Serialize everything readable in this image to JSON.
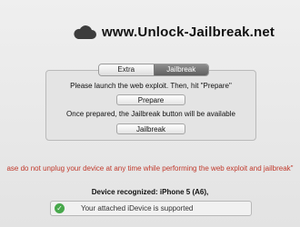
{
  "header": {
    "logo_icon": "cloud-icon",
    "site_title": "www.Unlock-Jailbreak.net"
  },
  "tabs": [
    {
      "label": "Extra",
      "active": false
    },
    {
      "label": "Jailbreak",
      "active": true
    }
  ],
  "panel": {
    "instruction_1": "Please launch the web exploit.  Then, hit \"Prepare\"",
    "prepare_label": "Prepare",
    "instruction_2": "Once prepared, the Jailbreak button will be available",
    "jailbreak_label": "Jailbreak"
  },
  "warning": "ase do not unplug your device at any time while performing the web exploit and jailbreak\"",
  "device": {
    "recognized_text": "Device recognized:  iPhone 5 (A6),"
  },
  "support": {
    "icon": "check-icon",
    "text": "Your attached iDevice is supported",
    "color": "#47a84b"
  },
  "colors": {
    "warning": "#c0392b",
    "active_tab": "#6f6f6f"
  }
}
